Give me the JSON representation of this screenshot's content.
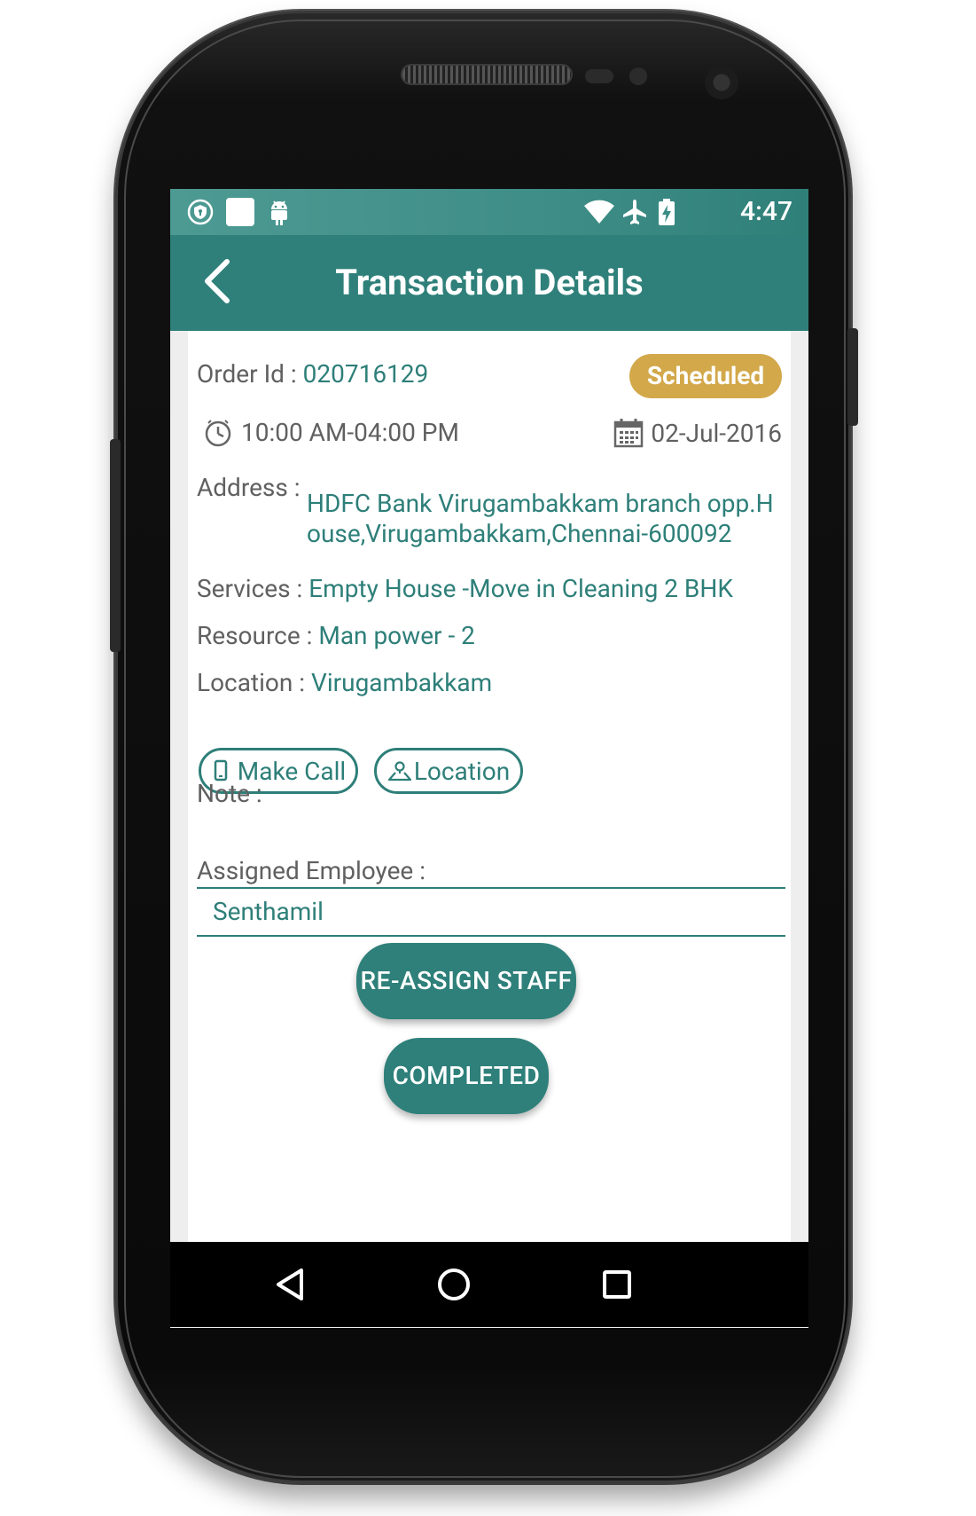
{
  "status_bar": {
    "time": "4:47",
    "left_icons": [
      "vpn-shield-icon",
      "notification-square-icon",
      "android-icon"
    ],
    "right_icons": [
      "wifi-icon",
      "airplane-mode-icon",
      "battery-charging-icon"
    ]
  },
  "app_bar": {
    "title": "Transaction Details",
    "back_icon": "chevron-left-icon"
  },
  "order": {
    "order_id_label": "Order Id : ",
    "order_id_value": "020716129",
    "status": "Scheduled",
    "time_range": "10:00 AM-04:00 PM",
    "date": "02-Jul-2016",
    "address_label": "Address : ",
    "address_value": "HDFC Bank  Virugambakkam branch opp.House,Virugambakkam,Chennai-600092",
    "services_label": "Services : ",
    "services_value": "Empty House -Move in Cleaning 2 BHK",
    "resource_label": "Resource : ",
    "resource_value": "Man power - 2",
    "location_label": "Location : ",
    "location_value": "Virugambakkam"
  },
  "buttons": {
    "make_call": "Make Call",
    "location": "Location",
    "reassign": "RE-ASSIGN STAFF",
    "completed": "COMPLETED"
  },
  "note": {
    "label": "Note :"
  },
  "assigned": {
    "label": "Assigned Employee :",
    "value": "Senthamil"
  },
  "colors": {
    "primary": "#2f807a",
    "accent_badge": "#d2a84a",
    "value_text": "#2e7f79",
    "label_text": "#606060"
  }
}
